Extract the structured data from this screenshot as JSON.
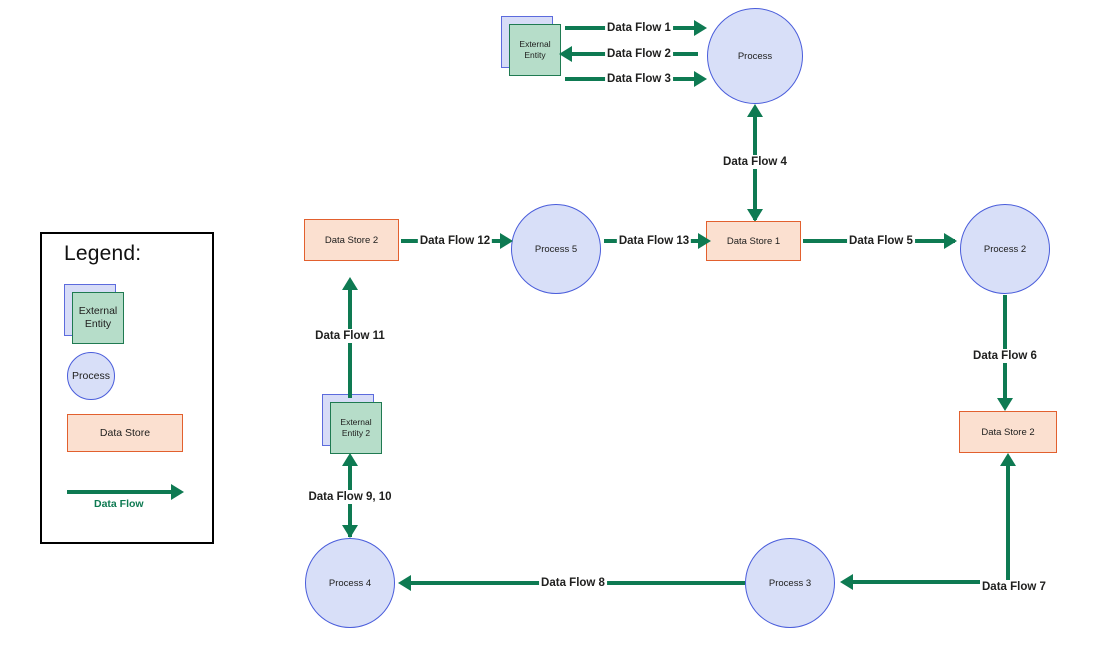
{
  "diagram": {
    "type": "data-flow-diagram",
    "colors": {
      "flow_green": "#0e7a52",
      "process_fill": "#d8dff8",
      "process_stroke": "#4a5ddb",
      "datastore_fill": "#fbe0d0",
      "datastore_stroke": "#e2602e",
      "entity_front_fill": "#b6ddc9",
      "entity_front_stroke": "#1f7a51",
      "entity_back_fill": "#d7dcf7",
      "entity_back_stroke": "#5c6bdd",
      "legend_border": "#000000",
      "text": "#20201f"
    }
  },
  "legend": {
    "title": "Legend:",
    "external_entity_label": "External\nEntity",
    "external_entity_line1": "External",
    "external_entity_line2": "Entity",
    "process_label": "Process",
    "datastore_label": "Data Store",
    "dataflow_label": "Data Flow"
  },
  "nodes": {
    "external_entity_top": {
      "label_line1": "External",
      "label_line2": "Entity"
    },
    "process_top": {
      "label": "Process"
    },
    "datastore_2_left": {
      "label": "Data Store 2"
    },
    "process_5": {
      "label": "Process 5"
    },
    "datastore_1": {
      "label": "Data Store 1"
    },
    "process_2": {
      "label": "Process 2"
    },
    "datastore_2_right": {
      "label": "Data Store 2"
    },
    "external_entity_2": {
      "label_line1": "External",
      "label_line2": "Entity 2"
    },
    "process_4": {
      "label": "Process 4"
    },
    "process_3": {
      "label": "Process 3"
    }
  },
  "flows": [
    {
      "id": "df1",
      "label": "Data Flow 1",
      "from": "external_entity_top",
      "to": "process_top",
      "direction": "right"
    },
    {
      "id": "df2",
      "label": "Data Flow 2",
      "from": "process_top",
      "to": "external_entity_top",
      "direction": "left"
    },
    {
      "id": "df3",
      "label": "Data Flow 3",
      "from": "external_entity_top",
      "to": "process_top",
      "direction": "right"
    },
    {
      "id": "df4",
      "label": "Data Flow 4",
      "from": "datastore_1",
      "to": "process_top",
      "direction": "bidirectional-vertical"
    },
    {
      "id": "df5",
      "label": "Data Flow 5",
      "from": "datastore_1",
      "to": "process_2",
      "direction": "right"
    },
    {
      "id": "df6",
      "label": "Data Flow 6",
      "from": "process_2",
      "to": "datastore_2_right",
      "direction": "down"
    },
    {
      "id": "df7",
      "label": "Data Flow 7",
      "from": "process_3",
      "to": "datastore_2_right",
      "direction": "up-and-left"
    },
    {
      "id": "df8",
      "label": "Data Flow 8",
      "from": "process_3",
      "to": "process_4",
      "direction": "left"
    },
    {
      "id": "df910",
      "label": "Data Flow 9, 10",
      "from": "process_4",
      "to": "external_entity_2",
      "direction": "bidirectional-vertical"
    },
    {
      "id": "df11",
      "label": "Data Flow 11",
      "from": "external_entity_2",
      "to": "datastore_2_left",
      "direction": "up"
    },
    {
      "id": "df12",
      "label": "Data Flow 12",
      "from": "datastore_2_left",
      "to": "process_5",
      "direction": "right"
    },
    {
      "id": "df13",
      "label": "Data Flow 13",
      "from": "process_5",
      "to": "datastore_1",
      "direction": "right"
    }
  ]
}
